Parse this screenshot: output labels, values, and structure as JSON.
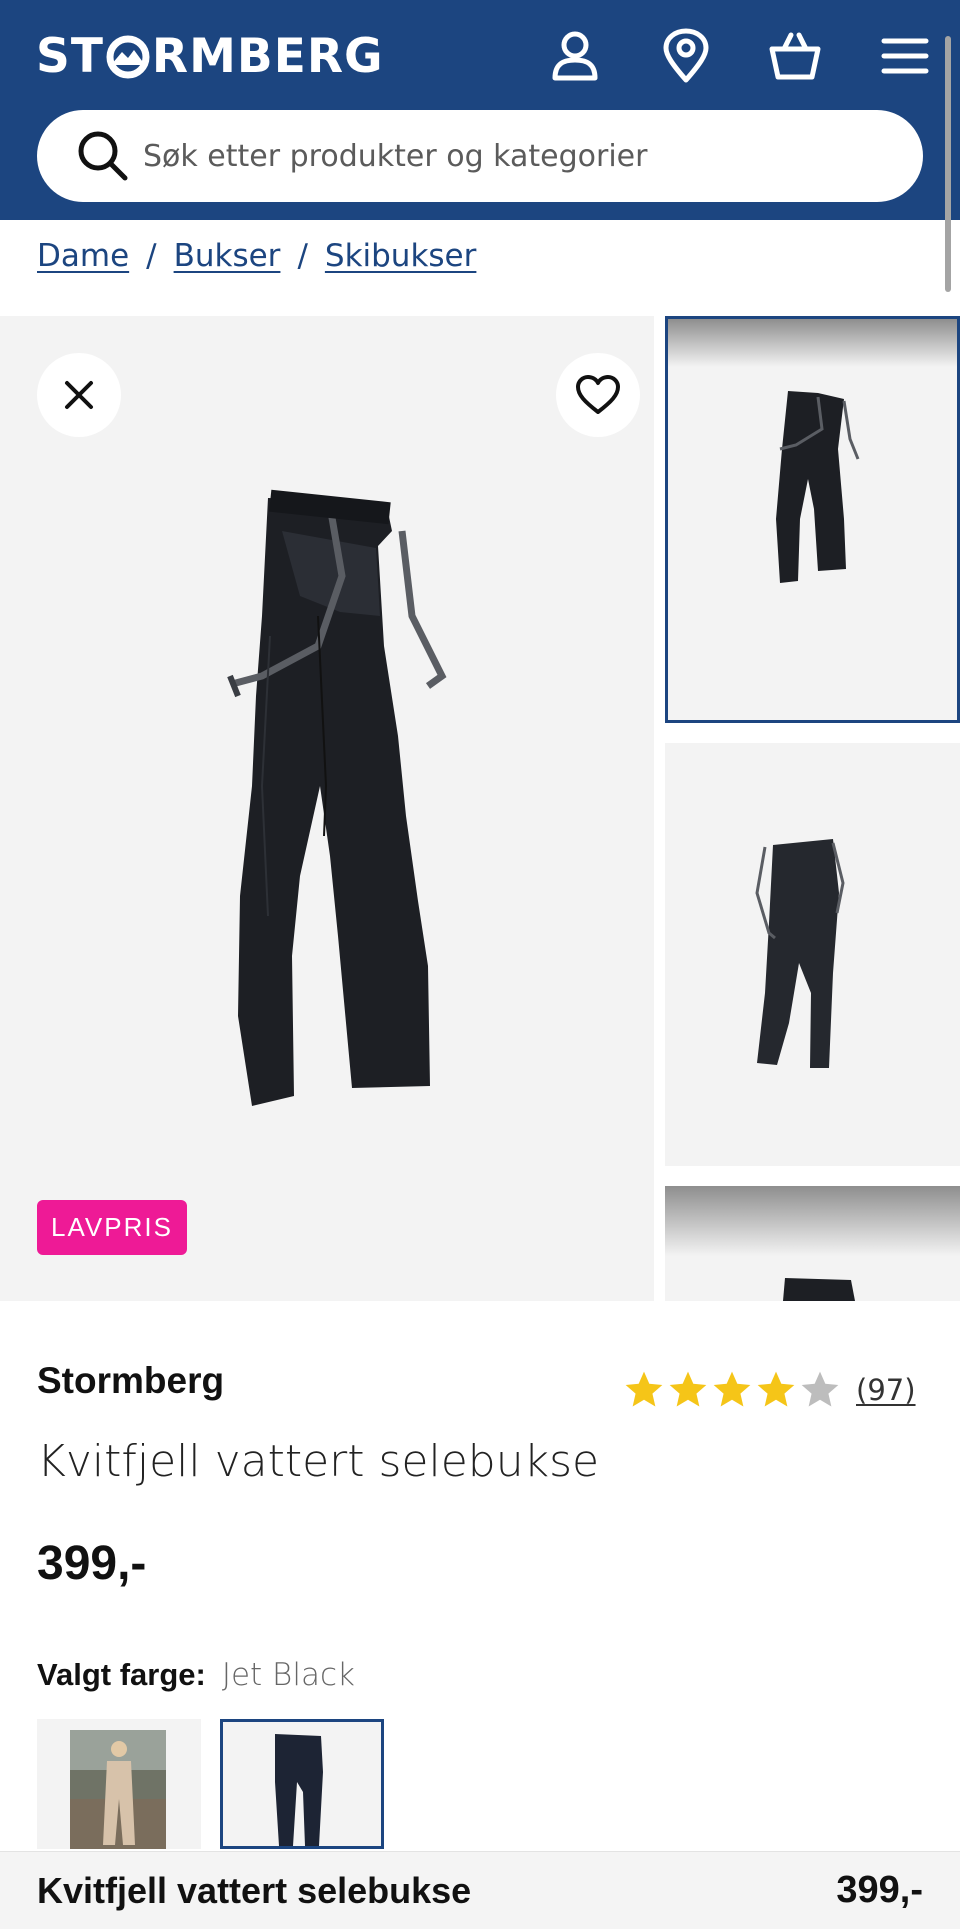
{
  "header": {
    "logo_text_1": "ST",
    "logo_text_2": "RMBERG",
    "icons": [
      "account-icon",
      "store-locator-icon",
      "cart-icon",
      "menu-icon"
    ],
    "brand_color": "#1c4580"
  },
  "search": {
    "placeholder": "Søk etter produkter og kategorier"
  },
  "breadcrumb": {
    "items": [
      "Dame",
      "Bukser",
      "Skibukser"
    ],
    "separator": "/"
  },
  "gallery": {
    "badge": "LAVPRIS",
    "badge_color": "#ee1a96",
    "thumbnails_count": 3,
    "selected_thumbnail": 1
  },
  "product": {
    "brand": "Stormberg",
    "rating_value": 4,
    "rating_max": 5,
    "review_count": "(97)",
    "title": "Kvitfjell vattert selebukse",
    "price": "399,-",
    "color_label": "Valgt farge:",
    "color_value": "Jet Black",
    "star_color": "#f5c518"
  },
  "sticky_bar": {
    "name": "Kvitfjell vattert selebukse",
    "price": "399,-"
  }
}
